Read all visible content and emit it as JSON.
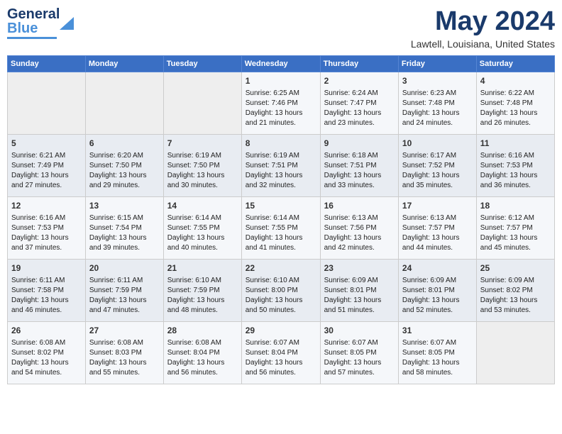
{
  "header": {
    "logo": {
      "line1": "General",
      "line2": "Blue"
    },
    "title": "May 2024",
    "location": "Lawtell, Louisiana, United States"
  },
  "weekdays": [
    "Sunday",
    "Monday",
    "Tuesday",
    "Wednesday",
    "Thursday",
    "Friday",
    "Saturday"
  ],
  "weeks": [
    [
      {
        "day": "",
        "empty": true
      },
      {
        "day": "",
        "empty": true
      },
      {
        "day": "",
        "empty": true
      },
      {
        "day": "1",
        "sunrise": "6:25 AM",
        "sunset": "7:46 PM",
        "daylight": "13 hours and 21 minutes."
      },
      {
        "day": "2",
        "sunrise": "6:24 AM",
        "sunset": "7:47 PM",
        "daylight": "13 hours and 23 minutes."
      },
      {
        "day": "3",
        "sunrise": "6:23 AM",
        "sunset": "7:48 PM",
        "daylight": "13 hours and 24 minutes."
      },
      {
        "day": "4",
        "sunrise": "6:22 AM",
        "sunset": "7:48 PM",
        "daylight": "13 hours and 26 minutes."
      }
    ],
    [
      {
        "day": "5",
        "sunrise": "6:21 AM",
        "sunset": "7:49 PM",
        "daylight": "13 hours and 27 minutes."
      },
      {
        "day": "6",
        "sunrise": "6:20 AM",
        "sunset": "7:50 PM",
        "daylight": "13 hours and 29 minutes."
      },
      {
        "day": "7",
        "sunrise": "6:19 AM",
        "sunset": "7:50 PM",
        "daylight": "13 hours and 30 minutes."
      },
      {
        "day": "8",
        "sunrise": "6:19 AM",
        "sunset": "7:51 PM",
        "daylight": "13 hours and 32 minutes."
      },
      {
        "day": "9",
        "sunrise": "6:18 AM",
        "sunset": "7:51 PM",
        "daylight": "13 hours and 33 minutes."
      },
      {
        "day": "10",
        "sunrise": "6:17 AM",
        "sunset": "7:52 PM",
        "daylight": "13 hours and 35 minutes."
      },
      {
        "day": "11",
        "sunrise": "6:16 AM",
        "sunset": "7:53 PM",
        "daylight": "13 hours and 36 minutes."
      }
    ],
    [
      {
        "day": "12",
        "sunrise": "6:16 AM",
        "sunset": "7:53 PM",
        "daylight": "13 hours and 37 minutes."
      },
      {
        "day": "13",
        "sunrise": "6:15 AM",
        "sunset": "7:54 PM",
        "daylight": "13 hours and 39 minutes."
      },
      {
        "day": "14",
        "sunrise": "6:14 AM",
        "sunset": "7:55 PM",
        "daylight": "13 hours and 40 minutes."
      },
      {
        "day": "15",
        "sunrise": "6:14 AM",
        "sunset": "7:55 PM",
        "daylight": "13 hours and 41 minutes."
      },
      {
        "day": "16",
        "sunrise": "6:13 AM",
        "sunset": "7:56 PM",
        "daylight": "13 hours and 42 minutes."
      },
      {
        "day": "17",
        "sunrise": "6:13 AM",
        "sunset": "7:57 PM",
        "daylight": "13 hours and 44 minutes."
      },
      {
        "day": "18",
        "sunrise": "6:12 AM",
        "sunset": "7:57 PM",
        "daylight": "13 hours and 45 minutes."
      }
    ],
    [
      {
        "day": "19",
        "sunrise": "6:11 AM",
        "sunset": "7:58 PM",
        "daylight": "13 hours and 46 minutes."
      },
      {
        "day": "20",
        "sunrise": "6:11 AM",
        "sunset": "7:59 PM",
        "daylight": "13 hours and 47 minutes."
      },
      {
        "day": "21",
        "sunrise": "6:10 AM",
        "sunset": "7:59 PM",
        "daylight": "13 hours and 48 minutes."
      },
      {
        "day": "22",
        "sunrise": "6:10 AM",
        "sunset": "8:00 PM",
        "daylight": "13 hours and 50 minutes."
      },
      {
        "day": "23",
        "sunrise": "6:09 AM",
        "sunset": "8:01 PM",
        "daylight": "13 hours and 51 minutes."
      },
      {
        "day": "24",
        "sunrise": "6:09 AM",
        "sunset": "8:01 PM",
        "daylight": "13 hours and 52 minutes."
      },
      {
        "day": "25",
        "sunrise": "6:09 AM",
        "sunset": "8:02 PM",
        "daylight": "13 hours and 53 minutes."
      }
    ],
    [
      {
        "day": "26",
        "sunrise": "6:08 AM",
        "sunset": "8:02 PM",
        "daylight": "13 hours and 54 minutes."
      },
      {
        "day": "27",
        "sunrise": "6:08 AM",
        "sunset": "8:03 PM",
        "daylight": "13 hours and 55 minutes."
      },
      {
        "day": "28",
        "sunrise": "6:08 AM",
        "sunset": "8:04 PM",
        "daylight": "13 hours and 56 minutes."
      },
      {
        "day": "29",
        "sunrise": "6:07 AM",
        "sunset": "8:04 PM",
        "daylight": "13 hours and 56 minutes."
      },
      {
        "day": "30",
        "sunrise": "6:07 AM",
        "sunset": "8:05 PM",
        "daylight": "13 hours and 57 minutes."
      },
      {
        "day": "31",
        "sunrise": "6:07 AM",
        "sunset": "8:05 PM",
        "daylight": "13 hours and 58 minutes."
      },
      {
        "day": "",
        "empty": true
      }
    ]
  ],
  "labels": {
    "sunrise": "Sunrise:",
    "sunset": "Sunset:",
    "daylight": "Daylight:"
  }
}
